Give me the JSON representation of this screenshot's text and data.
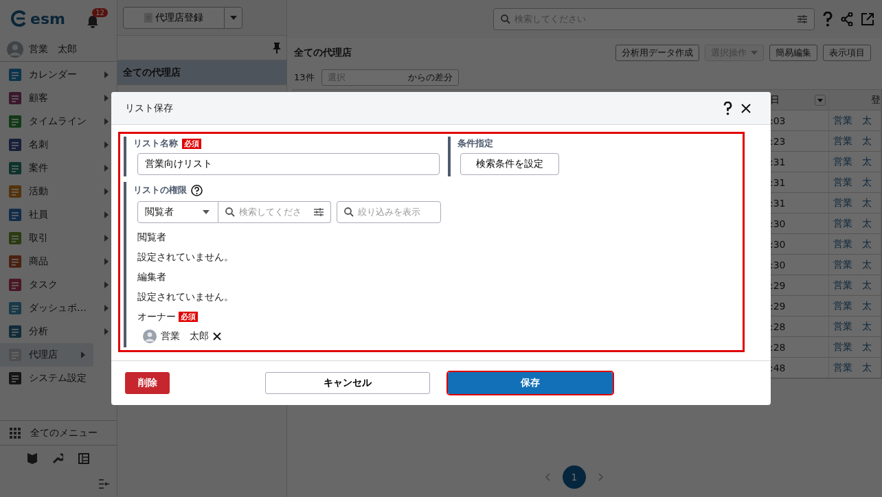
{
  "sidebar": {
    "logo": "esm",
    "notification_count": "12",
    "user": "営業　太郎",
    "menu": [
      {
        "label": "カレンダー",
        "submenu": true,
        "selected": false
      },
      {
        "label": "顧客",
        "submenu": true,
        "selected": false
      },
      {
        "label": "タイムライン",
        "submenu": true,
        "selected": false
      },
      {
        "label": "名刺",
        "submenu": true,
        "selected": false
      },
      {
        "label": "案件",
        "submenu": true,
        "selected": false
      },
      {
        "label": "活動",
        "submenu": true,
        "selected": false
      },
      {
        "label": "社員",
        "submenu": true,
        "selected": false
      },
      {
        "label": "取引",
        "submenu": true,
        "selected": false
      },
      {
        "label": "商品",
        "submenu": true,
        "selected": false
      },
      {
        "label": "タスク",
        "submenu": true,
        "selected": false
      },
      {
        "label": "ダッシュボ…",
        "submenu": true,
        "selected": false
      },
      {
        "label": "分析",
        "submenu": true,
        "selected": false
      },
      {
        "label": "代理店",
        "submenu": true,
        "selected": true
      },
      {
        "label": "システム設定",
        "submenu": false,
        "selected": false
      }
    ],
    "all_menu": "全てのメニュー"
  },
  "list_panel": {
    "register_button": "代理店登録",
    "lists": [
      {
        "label": "全ての代理店",
        "selected": true
      }
    ]
  },
  "topbar": {
    "search_placeholder": "検索してください"
  },
  "content": {
    "title": "全ての代理店",
    "buttons": [
      {
        "label": "分析用データ作成",
        "disabled": false,
        "menu": false
      },
      {
        "label": "選択操作",
        "disabled": true,
        "menu": true
      },
      {
        "label": "簡易編集",
        "disabled": false,
        "menu": false
      },
      {
        "label": "表示項目",
        "disabled": false,
        "menu": false
      }
    ],
    "count": "13件",
    "diff_placeholder": "選択",
    "diff_label": "からの差分",
    "table": {
      "columns": [
        "日",
        "登"
      ],
      "rows": [
        [
          ":03",
          "営業　太"
        ],
        [
          ":23",
          "営業　太"
        ],
        [
          ":31",
          "営業　太"
        ],
        [
          ":31",
          "営業　太"
        ],
        [
          ":31",
          "営業　太"
        ],
        [
          ":30",
          "営業　太"
        ],
        [
          ":30",
          "営業　太"
        ],
        [
          ":30",
          "営業　太"
        ],
        [
          ":29",
          "営業　太"
        ],
        [
          ":29",
          "営業　太"
        ],
        [
          ":28",
          "営業　太"
        ],
        [
          ":28",
          "営業　太"
        ],
        [
          ":48",
          "営業　太"
        ]
      ]
    },
    "pagination": [
      {
        "label": "1",
        "selected": true
      }
    ]
  },
  "dialog": {
    "title": "リスト保存",
    "highlighted": true,
    "list_name": {
      "label": "リスト名称",
      "required": "必須",
      "value": "営業向けリスト"
    },
    "conditions": {
      "label": "条件指定",
      "button": "検索条件を設定"
    },
    "permissions": {
      "label": "リストの権限",
      "role": "閲覧者",
      "search_placeholder": "検索してくださ",
      "filter_placeholder": "絞り込みを表示",
      "groups": [
        {
          "label": "閲覧者",
          "value": "設定されていません。"
        },
        {
          "label": "編集者",
          "value": "設定されていません。"
        }
      ],
      "owner": {
        "label": "オーナー",
        "required": "必須",
        "user": "営業　太郎"
      }
    },
    "buttons": [
      {
        "label": "削除",
        "kind": "danger",
        "highlighted": false
      },
      {
        "label": "キャンセル",
        "kind": "secondary",
        "highlighted": false
      },
      {
        "label": "保存",
        "kind": "primary",
        "highlighted": true
      }
    ]
  }
}
